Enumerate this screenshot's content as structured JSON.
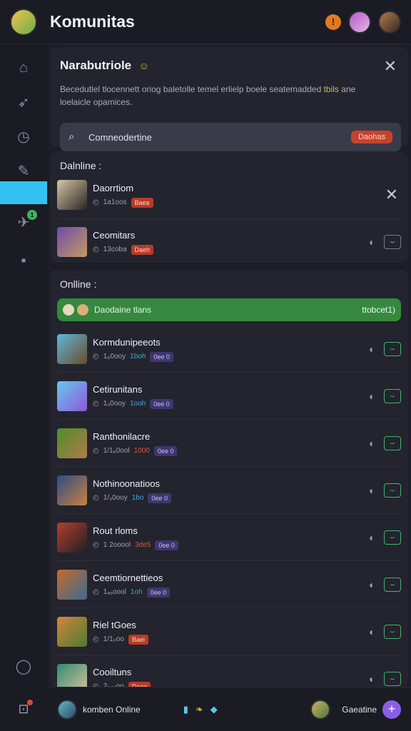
{
  "header": {
    "brand": "Komunitas",
    "icons": [
      "user-avatar",
      "notification-icon",
      "friend-avatar-1",
      "friend-avatar-2"
    ]
  },
  "sidebar": {
    "items": [
      "home-icon",
      "rocket-icon",
      "timer-icon",
      "leaf-icon",
      "active-tab",
      "badge-game-icon",
      "library-icon"
    ],
    "badge_count": "1"
  },
  "panel": {
    "title": "Narabutriole",
    "title_emoji": "☺",
    "description_main": "Becedutlel tlocennett oriog baletolle temel erlielp boele seatemadded",
    "description_highlight": "tbils",
    "description_tail": "ane loelaicle opamices.",
    "search_placeholder": "Comneodertine",
    "search_tag": "Daohas"
  },
  "online_top": {
    "header": "Dalnline :",
    "rows": [
      {
        "name": "Daorrtiom",
        "meta": "1a1oos",
        "tag": "Baea",
        "tag_style": "red",
        "trailing": "close"
      },
      {
        "name": "Ceomitars",
        "meta": "13coba",
        "tag": "Daeh",
        "tag_style": "red",
        "trailing": "box"
      }
    ]
  },
  "online_list": {
    "header": "Onlline :",
    "banner_text": "Daodaine tlans",
    "banner_right": "ttobcet1)",
    "rows": [
      {
        "name": "Kormdunipeeots",
        "meta": "1₈0ooy",
        "tag_color": "1boh",
        "tag_color_hex": "#3aa9d6",
        "pill": "0ee 0"
      },
      {
        "name": "Cetirunitans",
        "meta": "1₉0ooy",
        "tag_color": "1ooh",
        "tag_color_hex": "#3aa9d6",
        "pill": "0ee 0"
      },
      {
        "name": "Ranthonilacre",
        "meta": "1/1₈0ool",
        "tag_color": "1000",
        "tag_color_hex": "#d8583a",
        "pill": "0ee 0"
      },
      {
        "name": "Nothinoonatioos",
        "meta": "1/₉0ooy",
        "tag_color": "1bo",
        "tag_color_hex": "#3aa9d6",
        "pill": "0ee 0"
      },
      {
        "name": "Rout rloms",
        "meta": "1 2ooool",
        "tag_color": "3de5",
        "tag_color_hex": "#d8583a",
        "pill": "0ee 0"
      },
      {
        "name": "Ceemtiornettieos",
        "meta": "1ₐ₉oool",
        "tag_color": "1oh",
        "tag_color_hex": "#3aa9d6",
        "pill": "0ee 0"
      },
      {
        "name": "Riel tGoes",
        "meta": "1/1₀oo",
        "tag_color": "",
        "tag_color_hex": "",
        "pill": "Baei",
        "pill_style": "red"
      },
      {
        "name": "Cooiltuns",
        "meta": "2₀₄₀oo",
        "tag_color": "",
        "tag_color_hex": "",
        "pill": "Daee",
        "pill_style": "red"
      }
    ]
  },
  "bottom": {
    "left_label": "komben Online",
    "right_label": "Gaeatine",
    "plus": "+"
  },
  "colors": {
    "accent_blue": "#33c2f0",
    "green_banner": "#35883e",
    "red_tag": "#c6432b",
    "purple_button": "#8a5fe8"
  }
}
